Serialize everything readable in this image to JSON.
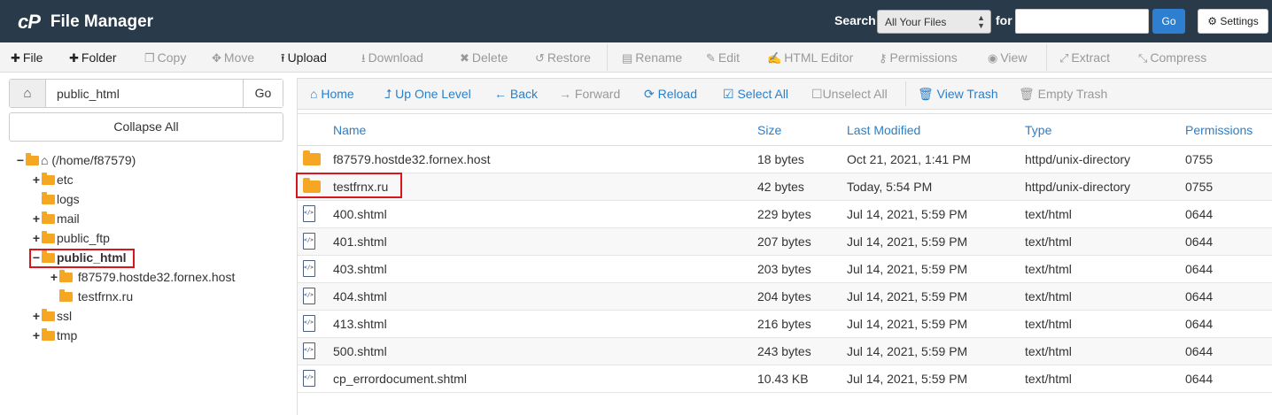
{
  "header": {
    "logo": "cP",
    "title": "File Manager",
    "search_label": "Search",
    "search_scope": "All Your Files",
    "for_label": "for",
    "search_value": "",
    "go_label": "Go",
    "settings_label": "Settings"
  },
  "toolbar": {
    "file": "File",
    "folder": "Folder",
    "copy": "Copy",
    "move": "Move",
    "upload": "Upload",
    "download": "Download",
    "delete": "Delete",
    "restore": "Restore",
    "rename": "Rename",
    "edit": "Edit",
    "html_editor": "HTML Editor",
    "permissions": "Permissions",
    "view": "View",
    "extract": "Extract",
    "compress": "Compress"
  },
  "sidebar": {
    "path_value": "public_html",
    "go_label": "Go",
    "collapse_label": "Collapse All",
    "tree": [
      {
        "label": "(/home/f87579)",
        "toggle": "−"
      },
      {
        "label": "etc",
        "toggle": "+"
      },
      {
        "label": "logs",
        "toggle": ""
      },
      {
        "label": "mail",
        "toggle": "+"
      },
      {
        "label": "public_ftp",
        "toggle": "+"
      },
      {
        "label": "public_html",
        "toggle": "−"
      },
      {
        "label": "f87579.hostde32.fornex.host",
        "toggle": "+"
      },
      {
        "label": "testfrnx.ru",
        "toggle": ""
      },
      {
        "label": "ssl",
        "toggle": "+"
      },
      {
        "label": "tmp",
        "toggle": "+"
      }
    ]
  },
  "nav": {
    "home": "Home",
    "up": "Up One Level",
    "back": "Back",
    "forward": "Forward",
    "reload": "Reload",
    "select_all": "Select All",
    "unselect_all": "Unselect All",
    "view_trash": "View Trash",
    "empty_trash": "Empty Trash"
  },
  "table": {
    "columns": [
      "Name",
      "Size",
      "Last Modified",
      "Type",
      "Permissions"
    ],
    "rows": [
      {
        "icon": "folder-icon",
        "name": "f87579.hostde32.fornex.host",
        "size": "18 bytes",
        "modified": "Oct 21, 2021, 1:41 PM",
        "type": "httpd/unix-directory",
        "perms": "0755"
      },
      {
        "icon": "folder-icon",
        "name": "testfrnx.ru",
        "size": "42 bytes",
        "modified": "Today, 5:54 PM",
        "type": "httpd/unix-directory",
        "perms": "0755"
      },
      {
        "icon": "html-file-icon",
        "name": "400.shtml",
        "size": "229 bytes",
        "modified": "Jul 14, 2021, 5:59 PM",
        "type": "text/html",
        "perms": "0644"
      },
      {
        "icon": "html-file-icon",
        "name": "401.shtml",
        "size": "207 bytes",
        "modified": "Jul 14, 2021, 5:59 PM",
        "type": "text/html",
        "perms": "0644"
      },
      {
        "icon": "html-file-icon",
        "name": "403.shtml",
        "size": "203 bytes",
        "modified": "Jul 14, 2021, 5:59 PM",
        "type": "text/html",
        "perms": "0644"
      },
      {
        "icon": "html-file-icon",
        "name": "404.shtml",
        "size": "204 bytes",
        "modified": "Jul 14, 2021, 5:59 PM",
        "type": "text/html",
        "perms": "0644"
      },
      {
        "icon": "html-file-icon",
        "name": "413.shtml",
        "size": "216 bytes",
        "modified": "Jul 14, 2021, 5:59 PM",
        "type": "text/html",
        "perms": "0644"
      },
      {
        "icon": "html-file-icon",
        "name": "500.shtml",
        "size": "243 bytes",
        "modified": "Jul 14, 2021, 5:59 PM",
        "type": "text/html",
        "perms": "0644"
      },
      {
        "icon": "html-file-icon",
        "name": "cp_errordocument.shtml",
        "size": "10.43 KB",
        "modified": "Jul 14, 2021, 5:59 PM",
        "type": "text/html",
        "perms": "0644"
      }
    ]
  },
  "colors": {
    "header_bg": "#293a4a",
    "accent": "#2a7fc9",
    "folder": "#f5a623",
    "highlight": "#d9161e"
  }
}
